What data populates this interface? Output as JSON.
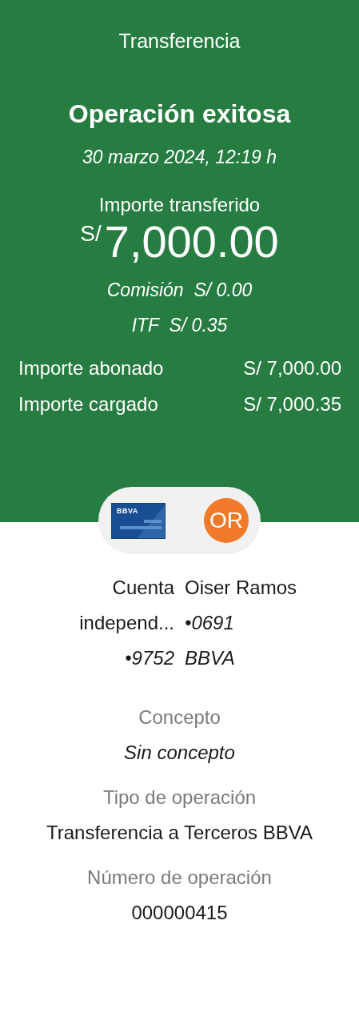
{
  "header": {
    "title": "Transferencia",
    "status": "Operación exitosa",
    "date": "30 marzo 2024, 12:19 h",
    "amount_label": "Importe transferido",
    "currency": "S/",
    "amount": "7,000.00",
    "fees": [
      "Comisión  S/ 0.00",
      "ITF  S/ 0.35"
    ],
    "totals": [
      {
        "label": "Importe abonado",
        "value": "S/ 7,000.00"
      },
      {
        "label": "Importe cargado",
        "value": "S/ 7,000.35"
      }
    ]
  },
  "parties": {
    "card_logo": "BBVA",
    "avatar_initials": "OR",
    "origin": [
      {
        "text": "Cuenta",
        "italic": false
      },
      {
        "text": "independ...",
        "italic": false
      },
      {
        "text": "•9752",
        "italic": true
      }
    ],
    "destination": [
      {
        "text": "Oiser Ramos",
        "italic": false
      },
      {
        "text": "•0691",
        "italic": true
      },
      {
        "text": "BBVA",
        "italic": true
      }
    ]
  },
  "details": [
    {
      "label": "Concepto",
      "value": "Sin concepto",
      "italic": true
    },
    {
      "label": "Tipo de operación",
      "value": "Transferencia a Terceros BBVA",
      "italic": false
    },
    {
      "label": "Número de operación",
      "value": "000000415",
      "italic": false
    }
  ]
}
